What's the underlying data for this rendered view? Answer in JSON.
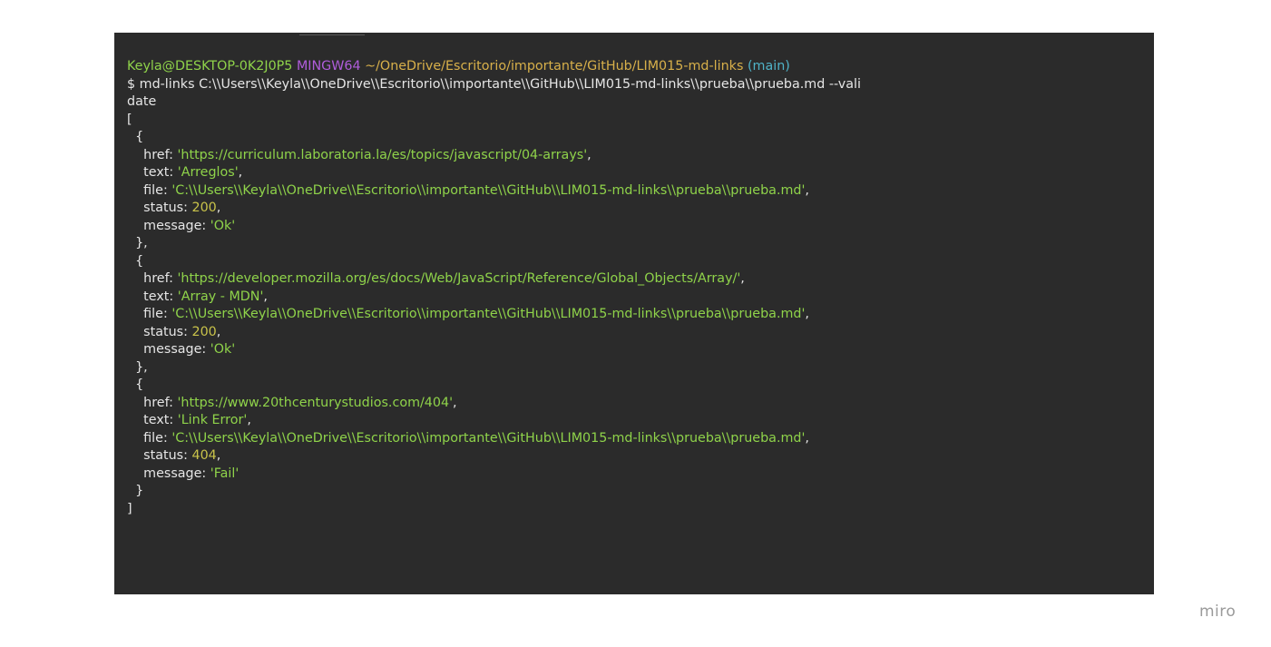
{
  "terminal": {
    "prompt": {
      "user_host": "Keyla@DESKTOP-0K2J0P5",
      "system": "MINGW64",
      "cwd": "~/OneDrive/Escritorio/importante/GitHub/LIM015-md-links",
      "branch": "(main)"
    },
    "command_line_1": "$ md-links C:\\\\Users\\\\Keyla\\\\OneDrive\\\\Escritorio\\\\importante\\\\GitHub\\\\LIM015-md-links\\\\prueba\\\\prueba.md --vali",
    "command_line_2": "date",
    "open_bracket": "[",
    "close_bracket": "]",
    "results": [
      {
        "open": "  {",
        "href": "'https://curriculum.laboratoria.la/es/topics/javascript/04-arrays'",
        "text": "'Arreglos'",
        "file": "'C:\\\\Users\\\\Keyla\\\\OneDrive\\\\Escritorio\\\\importante\\\\GitHub\\\\LIM015-md-links\\\\prueba\\\\prueba.md'",
        "status": "200",
        "message": "'Ok'",
        "close": "  },"
      },
      {
        "open": "  {",
        "href": "'https://developer.mozilla.org/es/docs/Web/JavaScript/Reference/Global_Objects/Array/'",
        "text": "'Array - MDN'",
        "file": "'C:\\\\Users\\\\Keyla\\\\OneDrive\\\\Escritorio\\\\importante\\\\GitHub\\\\LIM015-md-links\\\\prueba\\\\prueba.md'",
        "status": "200",
        "message": "'Ok'",
        "close": "  },"
      },
      {
        "open": "  {",
        "href": "'https://www.20thcenturystudios.com/404'",
        "text": "'Link Error'",
        "file": "'C:\\\\Users\\\\Keyla\\\\OneDrive\\\\Escritorio\\\\importante\\\\GitHub\\\\LIM015-md-links\\\\prueba\\\\prueba.md'",
        "status": "404",
        "message": "'Fail'",
        "close": "  }"
      }
    ],
    "keys": {
      "href": "    href: ",
      "text": "    text: ",
      "file": "    file: ",
      "status": "    status: ",
      "message": "    message: "
    },
    "comma": ",",
    "space": " "
  },
  "watermark": "miro",
  "colors": {
    "terminal_bg": "#2b2b2b",
    "user_host": "#8fd34a",
    "system": "#b05ddb",
    "cwd": "#d8b04a",
    "branch": "#4fb3c8",
    "string": "#8fd34a",
    "number": "#c9c34a"
  }
}
